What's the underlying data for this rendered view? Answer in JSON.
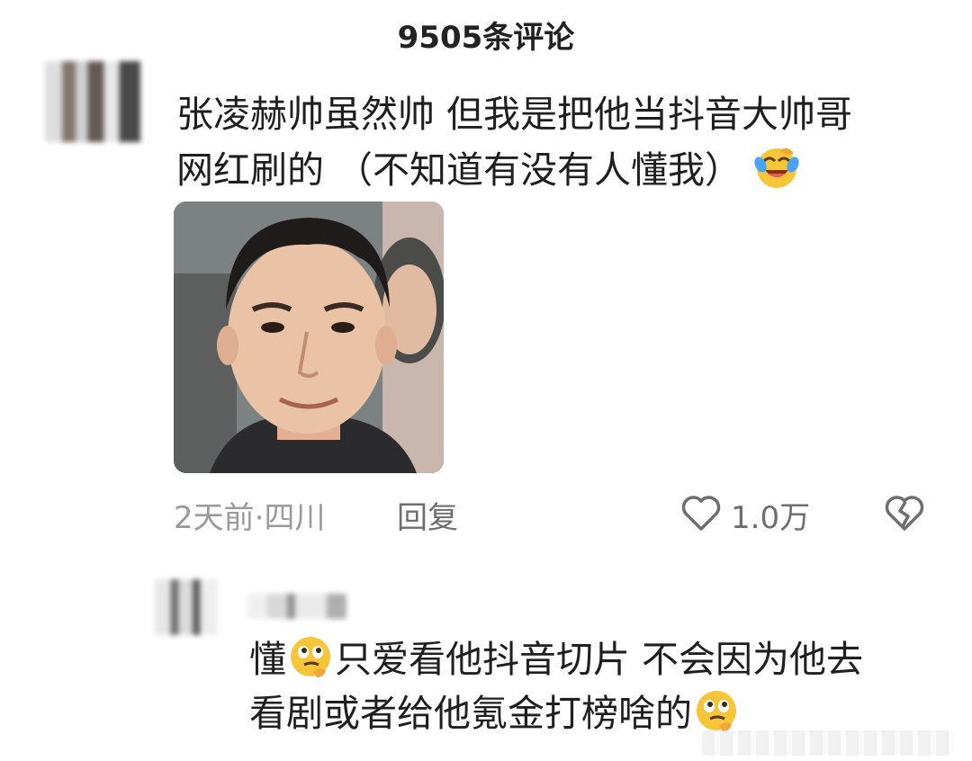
{
  "header": {
    "title": "9505条评论"
  },
  "comment": {
    "text_line1": "张凌赫帅虽然帅 但我是把他当抖音大帅哥",
    "text_line2": "网红刷的 （不知道有没有人懂我）",
    "emoji": "crying-laughing-emoji",
    "meta": "2天前·四川",
    "reply_label": "回复",
    "like_count": "1.0万"
  },
  "reply": {
    "text_part1": "懂",
    "text_part2": "只爱看他抖音切片 不会因为他去",
    "text_line2": "看剧或者给他氪金打榜啥的",
    "emoji": "thinking-face-emoji"
  },
  "colors": {
    "text": "#1f1f1f",
    "meta": "#9a9a9a",
    "action": "#6e6e6e",
    "background": "#ffffff"
  }
}
